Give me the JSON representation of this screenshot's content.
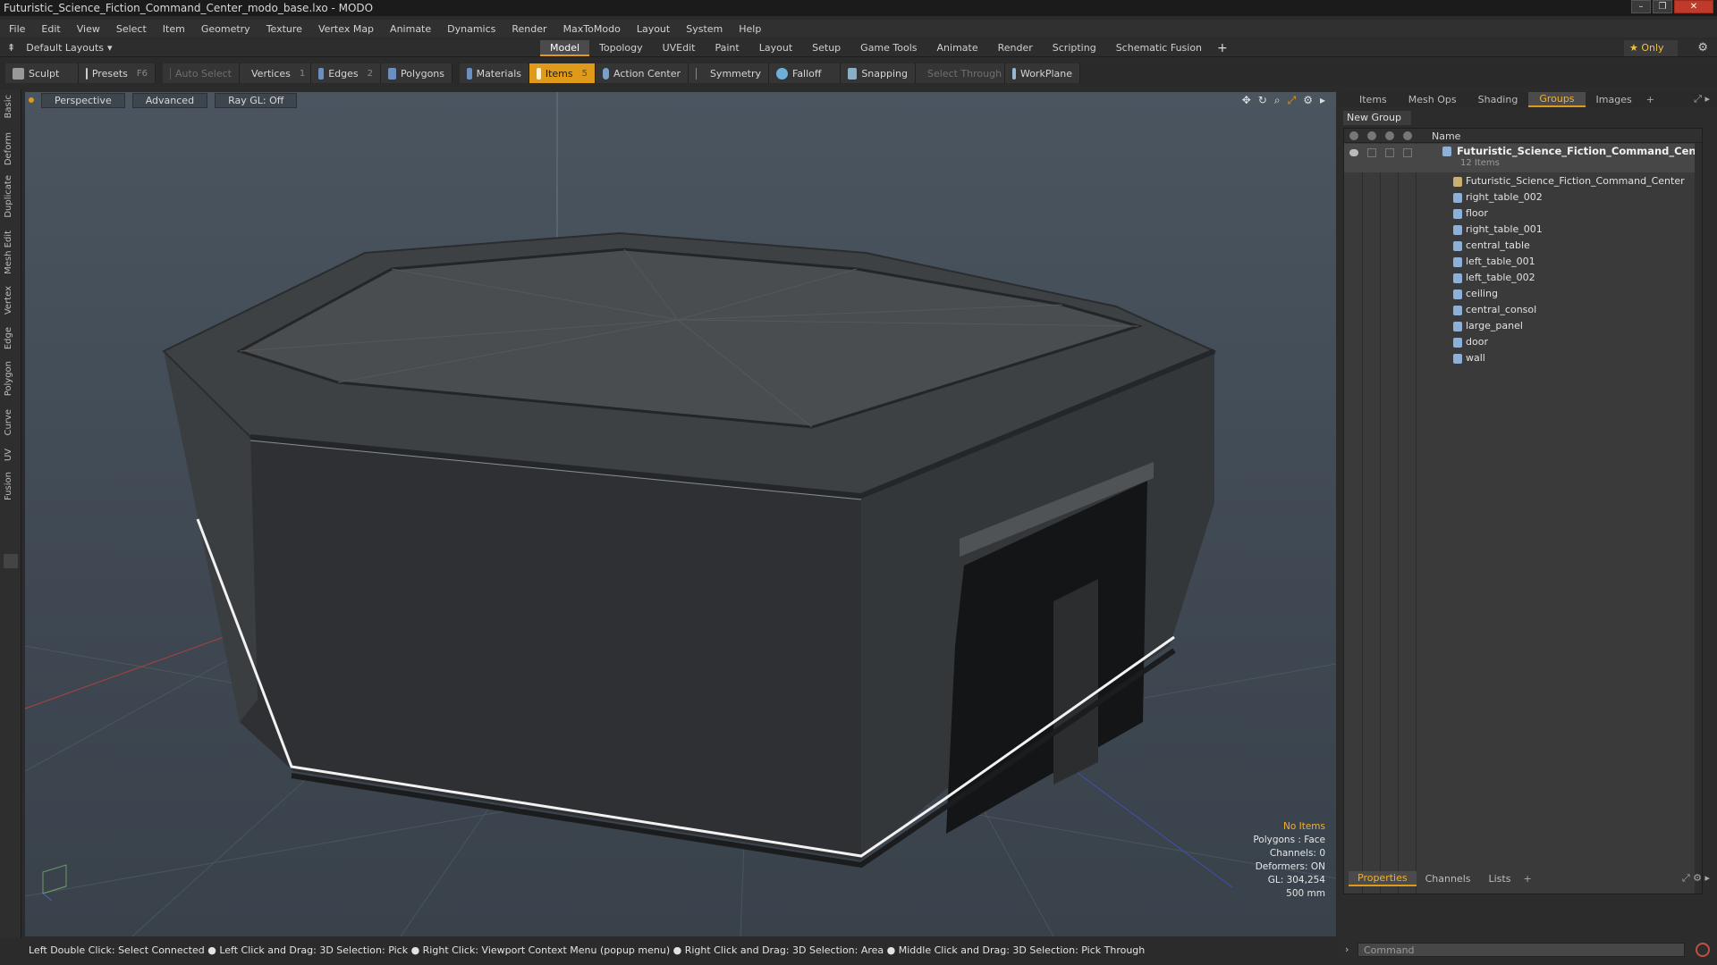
{
  "window": {
    "title": "Futuristic_Science_Fiction_Command_Center_modo_base.lxo - MODO",
    "buttons": [
      "–",
      "❐",
      "✕"
    ]
  },
  "menu": [
    "File",
    "Edit",
    "View",
    "Select",
    "Item",
    "Geometry",
    "Texture",
    "Vertex Map",
    "Animate",
    "Dynamics",
    "Render",
    "MaxToModo",
    "Layout",
    "System",
    "Help"
  ],
  "layoutbar": {
    "layouts_label": "Default Layouts",
    "tabs": [
      "Model",
      "Topology",
      "UVEdit",
      "Paint",
      "Layout",
      "Setup",
      "Game Tools",
      "Animate",
      "Render",
      "Scripting",
      "Schematic Fusion"
    ],
    "active_tab": "Model",
    "only_label": "★  Only"
  },
  "toolbar": {
    "sculpt": "Sculpt",
    "presets": "Presets",
    "presets_key": "F6",
    "auto_select": "Auto Select",
    "vertices": "Vertices",
    "vertices_key": "1",
    "edges": "Edges",
    "edges_key": "2",
    "polygons": "Polygons",
    "materials": "Materials",
    "items": "Items",
    "items_key": "5",
    "action_center": "Action Center",
    "symmetry": "Symmetry",
    "falloff": "Falloff",
    "snapping": "Snapping",
    "select_through": "Select Through",
    "workplane": "WorkPlane"
  },
  "lefttabs": [
    "Basic",
    "Deform",
    "Duplicate",
    "Mesh Edit",
    "Vertex",
    "Edge",
    "Polygon",
    "Curve",
    "UV",
    "Fusion"
  ],
  "viewport": {
    "perspective": "Perspective",
    "advanced": "Advanced",
    "raygl": "Ray GL: Off",
    "info": {
      "no_items": "No Items",
      "polygons": "Polygons : Face",
      "channels": "Channels: 0",
      "deformers": "Deformers: ON",
      "gl": "GL: 304,254",
      "scale": "500 mm"
    }
  },
  "statusbar": "Left Double Click: Select Connected ● Left Click and Drag: 3D Selection: Pick ● Right Click: Viewport Context Menu (popup menu) ● Right Click and Drag: 3D Selection: Area ● Middle Click and Drag: 3D Selection: Pick Through",
  "rightpanel": {
    "tabs": [
      "Items",
      "Mesh Ops",
      "Shading",
      "Groups",
      "Images"
    ],
    "active_tab": "Groups",
    "new_group": "New Group",
    "column_name": "Name",
    "group": {
      "name": "Futuristic_Science_Fiction_Command_Center ...",
      "count": "12 Items"
    },
    "items": [
      "Futuristic_Science_Fiction_Command_Center",
      "right_table_002",
      "floor",
      "right_table_001",
      "central_table",
      "left_table_001",
      "left_table_002",
      "ceiling",
      "central_consol",
      "large_panel",
      "door",
      "wall"
    ],
    "bottom_tabs": [
      "Properties",
      "Channels",
      "Lists"
    ],
    "bottom_active": "Properties",
    "command_placeholder": "Command"
  }
}
